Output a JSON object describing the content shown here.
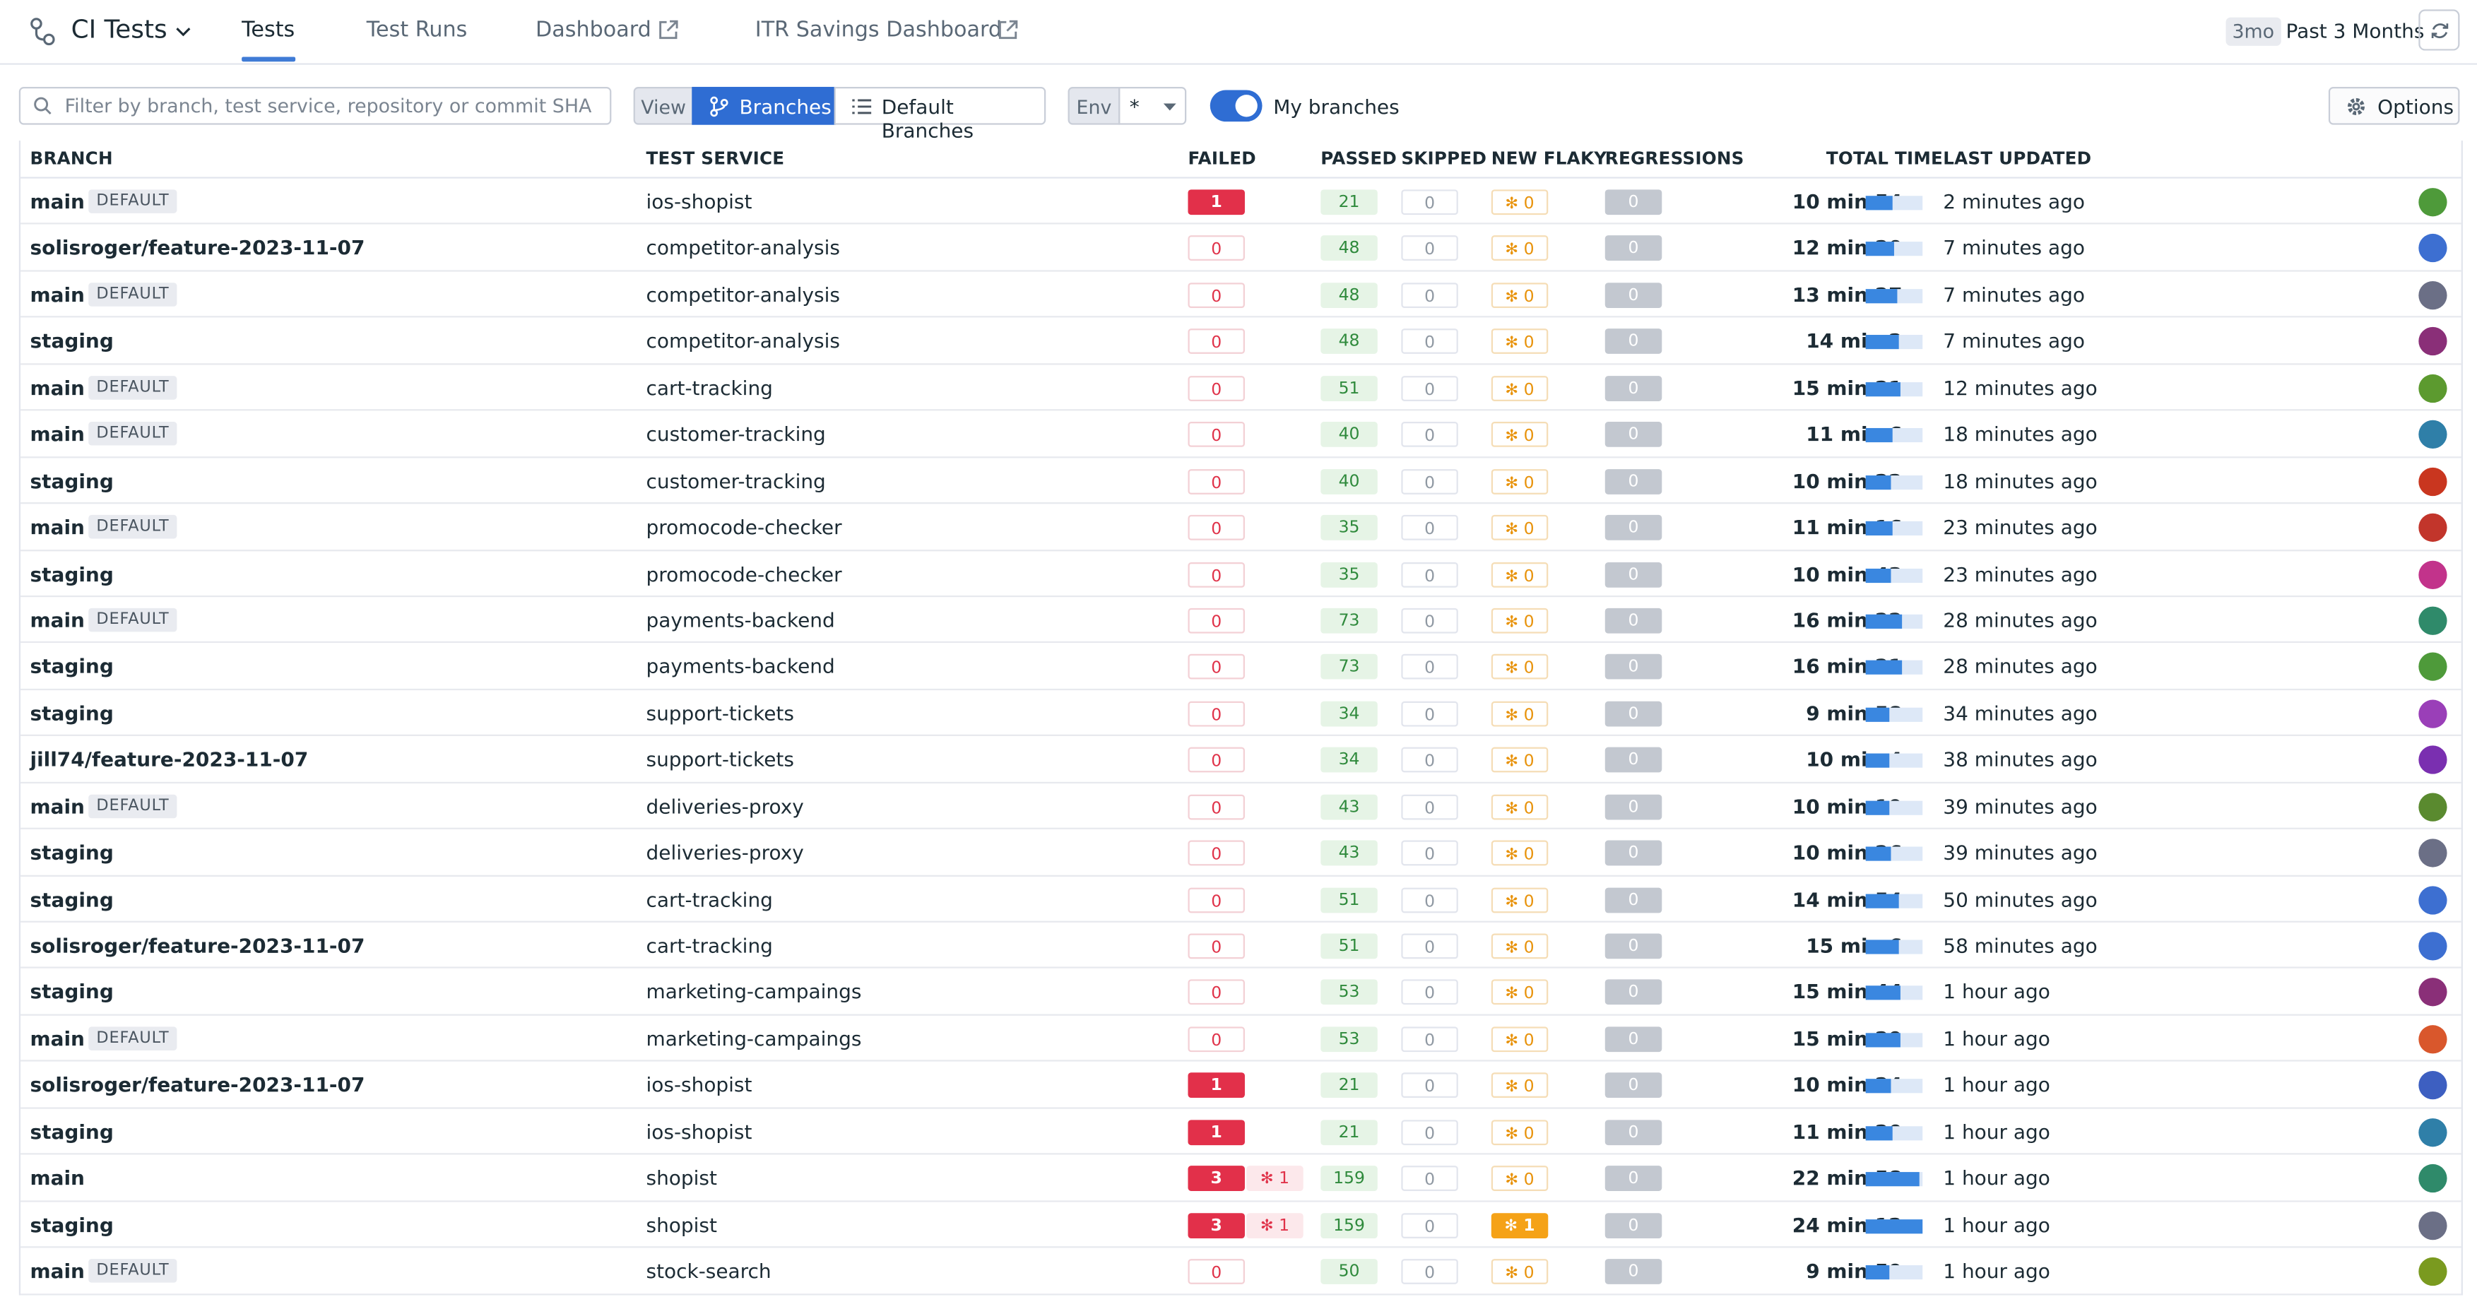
{
  "app": {
    "title": "CI Tests"
  },
  "nav": {
    "tabs": [
      "Tests",
      "Test Runs",
      "Dashboard",
      "ITR Savings Dashboard"
    ],
    "active": "Tests"
  },
  "timeframe": {
    "badge": "3mo",
    "label": "Past 3 Months"
  },
  "filters": {
    "search_placeholder": "Filter by branch, test service, repository or commit SHA",
    "view_label": "View",
    "view_options": [
      "Branches",
      "Default Branches"
    ],
    "view_selected": "Branches",
    "env_label": "Env",
    "env_value": "*",
    "toggle_label": "My branches",
    "toggle_on": true,
    "options_label": "Options"
  },
  "colors": {
    "accent": "#2f6dd3",
    "failed": "#e2304a",
    "passed": "#2f8a3c",
    "new_flaky": "#f5a217",
    "bar": "#3a87e0"
  },
  "table": {
    "columns": [
      "BRANCH",
      "TEST SERVICE",
      "FAILED",
      "PASSED",
      "SKIPPED",
      "NEW FLAKY",
      "REGRESSIONS",
      "TOTAL TIME",
      "LAST UPDATED"
    ],
    "default_tag": "DEFAULT",
    "rows": [
      {
        "branch": "main",
        "is_default": true,
        "service": "ios-shopist",
        "failed": "1",
        "flaky": "",
        "passed": "21",
        "skipped": "0",
        "new_flaky": "0",
        "regressions": "0",
        "total_time": "10 min 54 s",
        "time_fraction": 0.47,
        "updated": "2 minutes ago",
        "avatar_color": "#4e9a3a"
      },
      {
        "branch": "solisroger/feature-2023-11-07",
        "is_default": false,
        "service": "competitor-analysis",
        "failed": "0",
        "flaky": "",
        "passed": "48",
        "skipped": "0",
        "new_flaky": "0",
        "regressions": "0",
        "total_time": "12 min 20 s",
        "time_fraction": 0.5,
        "updated": "7 minutes ago",
        "avatar_color": "#3d6fd1"
      },
      {
        "branch": "main",
        "is_default": true,
        "service": "competitor-analysis",
        "failed": "0",
        "flaky": "",
        "passed": "48",
        "skipped": "0",
        "new_flaky": "0",
        "regressions": "0",
        "total_time": "13 min 27 s",
        "time_fraction": 0.55,
        "updated": "7 minutes ago",
        "avatar_color": "#6b6f86"
      },
      {
        "branch": "staging",
        "is_default": false,
        "service": "competitor-analysis",
        "failed": "0",
        "flaky": "",
        "passed": "48",
        "skipped": "0",
        "new_flaky": "0",
        "regressions": "0",
        "total_time": "14 min 2 s",
        "time_fraction": 0.57,
        "updated": "7 minutes ago",
        "avatar_color": "#8a2f78"
      },
      {
        "branch": "main",
        "is_default": true,
        "service": "cart-tracking",
        "failed": "0",
        "flaky": "",
        "passed": "51",
        "skipped": "0",
        "new_flaky": "0",
        "regressions": "0",
        "total_time": "15 min 21 s",
        "time_fraction": 0.6,
        "updated": "12 minutes ago",
        "avatar_color": "#5c9a2f"
      },
      {
        "branch": "main",
        "is_default": true,
        "service": "customer-tracking",
        "failed": "0",
        "flaky": "",
        "passed": "40",
        "skipped": "0",
        "new_flaky": "0",
        "regressions": "0",
        "total_time": "11 min 6 s",
        "time_fraction": 0.46,
        "updated": "18 minutes ago",
        "avatar_color": "#2f7fa8"
      },
      {
        "branch": "staging",
        "is_default": false,
        "service": "customer-tracking",
        "failed": "0",
        "flaky": "",
        "passed": "40",
        "skipped": "0",
        "new_flaky": "0",
        "regressions": "0",
        "total_time": "10 min 22 s",
        "time_fraction": 0.44,
        "updated": "18 minutes ago",
        "avatar_color": "#c9361f"
      },
      {
        "branch": "main",
        "is_default": true,
        "service": "promocode-checker",
        "failed": "0",
        "flaky": "",
        "passed": "35",
        "skipped": "0",
        "new_flaky": "0",
        "regressions": "0",
        "total_time": "11 min 16 s",
        "time_fraction": 0.47,
        "updated": "23 minutes ago",
        "avatar_color": "#c2352b"
      },
      {
        "branch": "staging",
        "is_default": false,
        "service": "promocode-checker",
        "failed": "0",
        "flaky": "",
        "passed": "35",
        "skipped": "0",
        "new_flaky": "0",
        "regressions": "0",
        "total_time": "10 min 43 s",
        "time_fraction": 0.45,
        "updated": "23 minutes ago",
        "avatar_color": "#c2338b"
      },
      {
        "branch": "main",
        "is_default": true,
        "service": "payments-backend",
        "failed": "0",
        "flaky": "",
        "passed": "73",
        "skipped": "0",
        "new_flaky": "0",
        "regressions": "0",
        "total_time": "16 min 22 s",
        "time_fraction": 0.64,
        "updated": "28 minutes ago",
        "avatar_color": "#2f8a6a"
      },
      {
        "branch": "staging",
        "is_default": false,
        "service": "payments-backend",
        "failed": "0",
        "flaky": "",
        "passed": "73",
        "skipped": "0",
        "new_flaky": "0",
        "regressions": "0",
        "total_time": "16 min 21 s",
        "time_fraction": 0.64,
        "updated": "28 minutes ago",
        "avatar_color": "#4e9a3a"
      },
      {
        "branch": "staging",
        "is_default": false,
        "service": "support-tickets",
        "failed": "0",
        "flaky": "",
        "passed": "34",
        "skipped": "0",
        "new_flaky": "0",
        "regressions": "0",
        "total_time": "9 min 58 s",
        "time_fraction": 0.42,
        "updated": "34 minutes ago",
        "avatar_color": "#9a3fb8"
      },
      {
        "branch": "jill74/feature-2023-11-07",
        "is_default": false,
        "service": "support-tickets",
        "failed": "0",
        "flaky": "",
        "passed": "34",
        "skipped": "0",
        "new_flaky": "0",
        "regressions": "0",
        "total_time": "10 min 4 s",
        "time_fraction": 0.42,
        "updated": "38 minutes ago",
        "avatar_color": "#7a2fb0"
      },
      {
        "branch": "main",
        "is_default": true,
        "service": "deliveries-proxy",
        "failed": "0",
        "flaky": "",
        "passed": "43",
        "skipped": "0",
        "new_flaky": "0",
        "regressions": "0",
        "total_time": "10 min 19 s",
        "time_fraction": 0.43,
        "updated": "39 minutes ago",
        "avatar_color": "#5a8a2f"
      },
      {
        "branch": "staging",
        "is_default": false,
        "service": "deliveries-proxy",
        "failed": "0",
        "flaky": "",
        "passed": "43",
        "skipped": "0",
        "new_flaky": "0",
        "regressions": "0",
        "total_time": "10 min 26 s",
        "time_fraction": 0.44,
        "updated": "39 minutes ago",
        "avatar_color": "#6b6f86"
      },
      {
        "branch": "staging",
        "is_default": false,
        "service": "cart-tracking",
        "failed": "0",
        "flaky": "",
        "passed": "51",
        "skipped": "0",
        "new_flaky": "0",
        "regressions": "0",
        "total_time": "14 min 54 s",
        "time_fraction": 0.58,
        "updated": "50 minutes ago",
        "avatar_color": "#3d6fd1"
      },
      {
        "branch": "solisroger/feature-2023-11-07",
        "is_default": false,
        "service": "cart-tracking",
        "failed": "0",
        "flaky": "",
        "passed": "51",
        "skipped": "0",
        "new_flaky": "0",
        "regressions": "0",
        "total_time": "15 min 6 s",
        "time_fraction": 0.59,
        "updated": "58 minutes ago",
        "avatar_color": "#3d6fd1"
      },
      {
        "branch": "staging",
        "is_default": false,
        "service": "marketing-campaings",
        "failed": "0",
        "flaky": "",
        "passed": "53",
        "skipped": "0",
        "new_flaky": "0",
        "regressions": "0",
        "total_time": "15 min 44 s",
        "time_fraction": 0.62,
        "updated": "1 hour ago",
        "avatar_color": "#8a2f78"
      },
      {
        "branch": "main",
        "is_default": true,
        "service": "marketing-campaings",
        "failed": "0",
        "flaky": "",
        "passed": "53",
        "skipped": "0",
        "new_flaky": "0",
        "regressions": "0",
        "total_time": "15 min 29 s",
        "time_fraction": 0.61,
        "updated": "1 hour ago",
        "avatar_color": "#d9572c"
      },
      {
        "branch": "solisroger/feature-2023-11-07",
        "is_default": false,
        "service": "ios-shopist",
        "failed": "1",
        "flaky": "",
        "passed": "21",
        "skipped": "0",
        "new_flaky": "0",
        "regressions": "0",
        "total_time": "10 min 24 s",
        "time_fraction": 0.44,
        "updated": "1 hour ago",
        "avatar_color": "#3d5fc1"
      },
      {
        "branch": "staging",
        "is_default": false,
        "service": "ios-shopist",
        "failed": "1",
        "flaky": "",
        "passed": "21",
        "skipped": "0",
        "new_flaky": "0",
        "regressions": "0",
        "total_time": "11 min 20 s",
        "time_fraction": 0.47,
        "updated": "1 hour ago",
        "avatar_color": "#2f7fa8"
      },
      {
        "branch": "main",
        "is_default": false,
        "service": "shopist",
        "failed": "3",
        "flaky": "1",
        "passed": "159",
        "skipped": "0",
        "new_flaky": "0",
        "regressions": "0",
        "total_time": "22 min 58 s",
        "time_fraction": 0.94,
        "updated": "1 hour ago",
        "avatar_color": "#2f8a6a"
      },
      {
        "branch": "staging",
        "is_default": false,
        "service": "shopist",
        "failed": "3",
        "flaky": "1",
        "passed": "159",
        "skipped": "0",
        "new_flaky": "1",
        "regressions": "0",
        "total_time": "24 min 12 s",
        "time_fraction": 1.0,
        "updated": "1 hour ago",
        "avatar_color": "#6b6f86"
      },
      {
        "branch": "main",
        "is_default": true,
        "service": "stock-search",
        "failed": "0",
        "flaky": "",
        "passed": "50",
        "skipped": "0",
        "new_flaky": "0",
        "regressions": "0",
        "total_time": "9 min 59 s",
        "time_fraction": 0.42,
        "updated": "1 hour ago",
        "avatar_color": "#7a9a1f"
      }
    ]
  }
}
